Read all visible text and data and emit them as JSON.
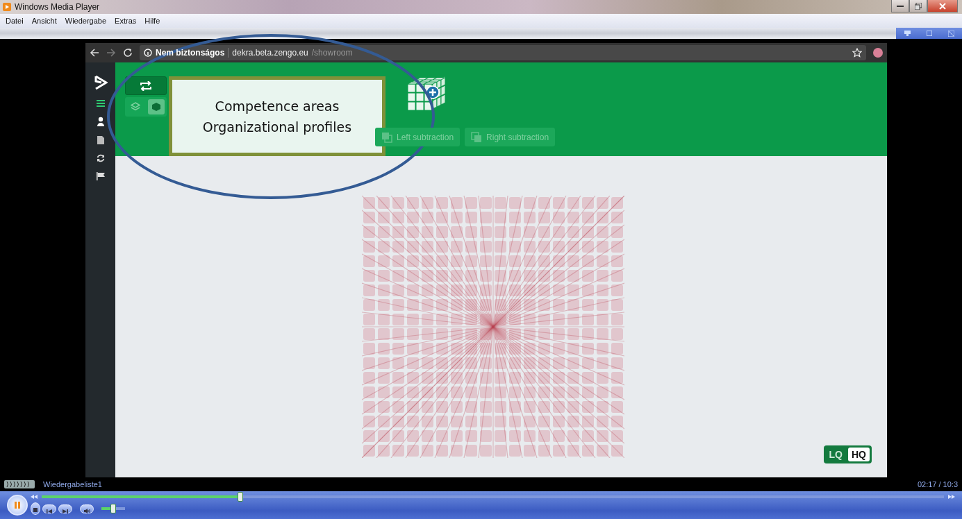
{
  "window": {
    "title": "Windows Media Player"
  },
  "menu": [
    "Datei",
    "Ansicht",
    "Wiedergabe",
    "Extras",
    "Hilfe"
  ],
  "browser": {
    "forward_disabled": true,
    "security": "Nem biztonságos",
    "url_host": "dekra.beta.zengo.eu",
    "url_path": "/showroom"
  },
  "app": {
    "toolbar_buttons": [
      "Left subtraction",
      "Right subtraction"
    ],
    "callout": [
      "Competence areas",
      "Organizational profiles"
    ],
    "view_modes": [
      {
        "kind": "layers",
        "selected": false
      },
      {
        "kind": "cube",
        "selected": true
      }
    ],
    "quality": [
      {
        "label": "LQ",
        "selected": false
      },
      {
        "label": "HQ",
        "selected": true
      }
    ]
  },
  "player": {
    "playlist": "Wiedergabeliste1",
    "time": "02:17 / 10:3",
    "playing": true,
    "seek": {
      "level": 0.22
    },
    "volume": {
      "level": 0.5
    }
  }
}
